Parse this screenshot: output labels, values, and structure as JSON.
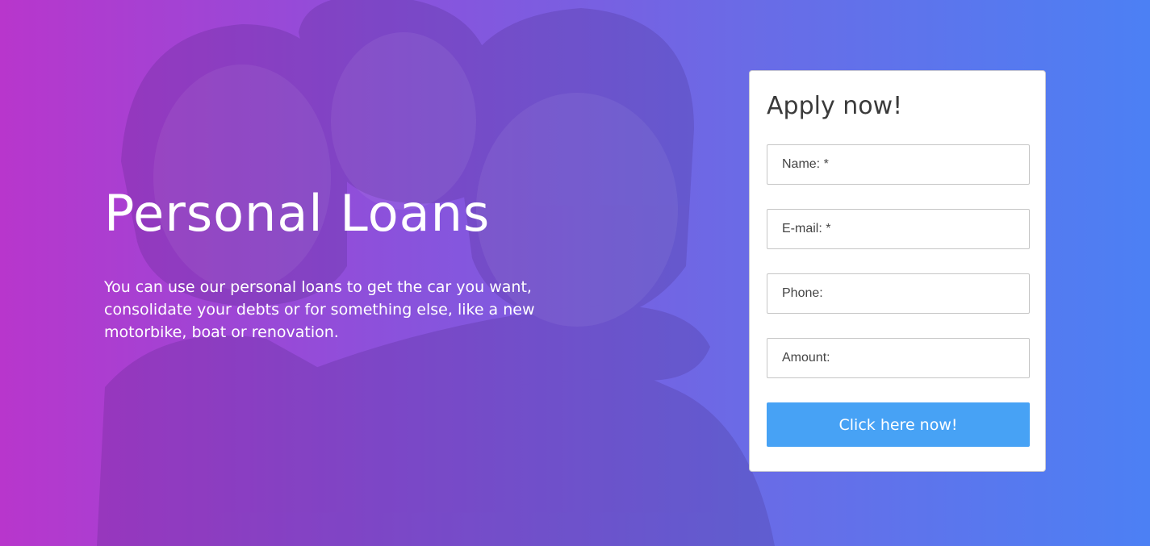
{
  "hero": {
    "title": "Personal Loans",
    "subtitle": "You can use our personal loans to get the car you want, consolidate your debts or for something else, like a new motorbike, boat or renovation."
  },
  "form": {
    "title": "Apply now!",
    "fields": {
      "name": {
        "placeholder": "Name: *"
      },
      "email": {
        "placeholder": "E-mail: *"
      },
      "phone": {
        "placeholder": "Phone:"
      },
      "amount": {
        "placeholder": "Amount:"
      }
    },
    "submit_label": "Click here now!"
  },
  "colors": {
    "gradient_left": "#b836cc",
    "gradient_right": "#4c80f4",
    "button": "#47a2f5",
    "card": "#ffffff",
    "title_text": "#3a3a3a"
  }
}
